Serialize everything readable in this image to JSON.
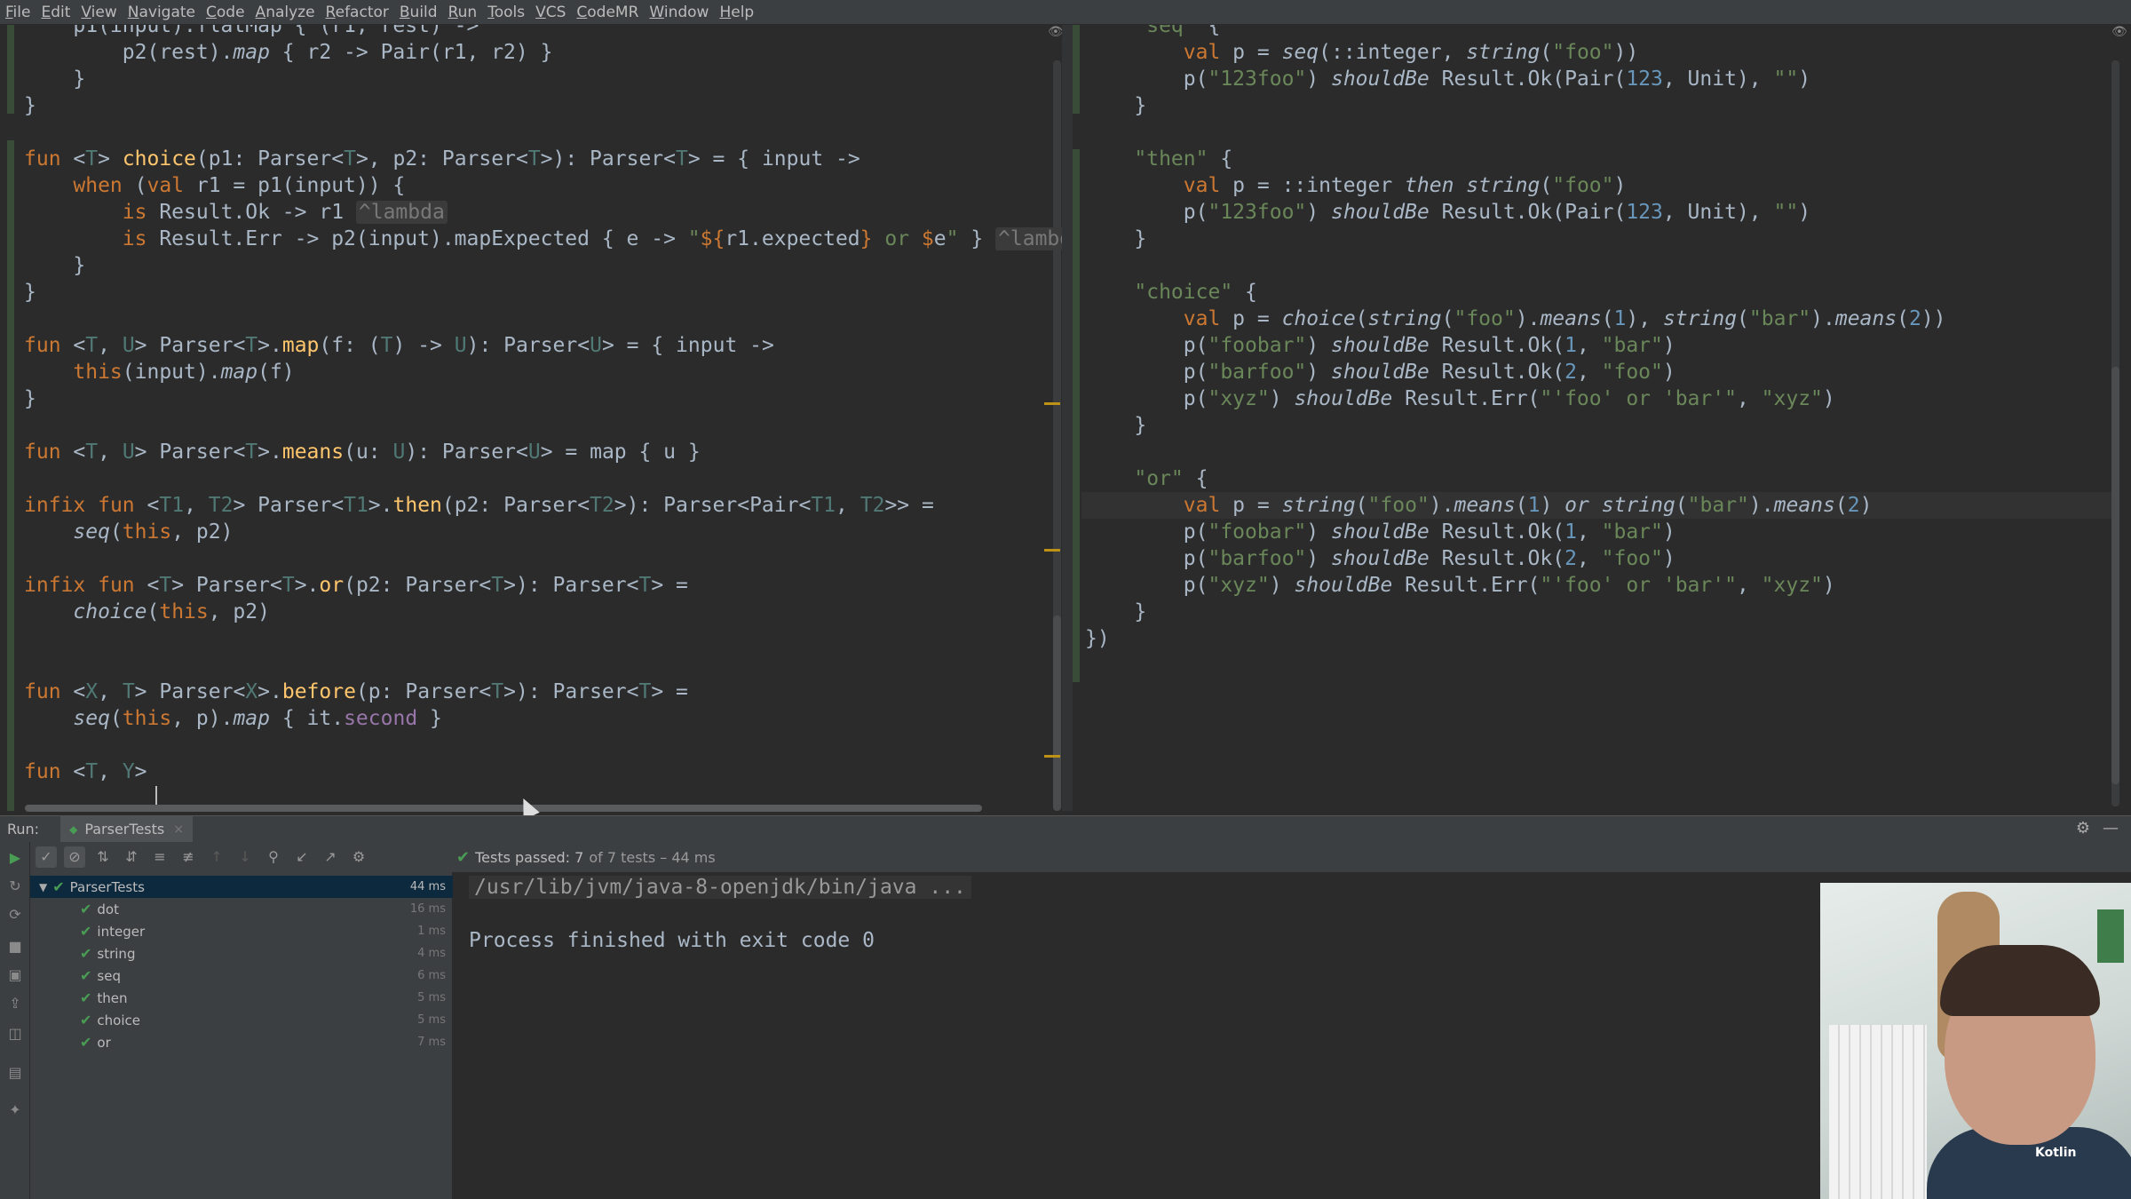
{
  "menubar": {
    "items": [
      "File",
      "Edit",
      "View",
      "Navigate",
      "Code",
      "Analyze",
      "Refactor",
      "Build",
      "Run",
      "Tools",
      "VCS",
      "CodeMR",
      "Window",
      "Help"
    ]
  },
  "editor_left": {
    "lines": [
      "    p1(input).flatMap { (r1, rest) ->",
      "        p2(rest).map { r2 -> Pair(r1, r2) }",
      "    }",
      "}",
      "",
      "fun <T> choice(p1: Parser<T>, p2: Parser<T>): Parser<T> = { input ->",
      "    when (val r1 = p1(input)) {",
      "        is Result.Ok -> r1 ^lambda",
      "        is Result.Err -> p2(input).mapExpected { e -> \"${r1.expected} or $e\" } ^lambd",
      "    }",
      "}",
      "",
      "fun <T, U> Parser<T>.map(f: (T) -> U): Parser<U> = { input ->",
      "    this(input).map(f)",
      "}",
      "",
      "fun <T, U> Parser<T>.means(u: U): Parser<U> = map { u }",
      "",
      "infix fun <T1, T2> Parser<T1>.then(p2: Parser<T2>): Parser<Pair<T1, T2>> =",
      "    seq(this, p2)",
      "",
      "infix fun <T> Parser<T>.or(p2: Parser<T>): Parser<T> =",
      "    choice(this, p2)",
      "",
      "",
      "fun <X, T> Parser<X>.before(p: Parser<T>): Parser<T> =",
      "    seq(this, p).map { it.second }",
      "",
      "fun <T, Y> "
    ]
  },
  "editor_right": {
    "lines": [
      "    \"seq\" {",
      "        val p = seq(::integer, string(\"foo\"))",
      "        p(\"123foo\") shouldBe Result.Ok(Pair(123, Unit), \"\")",
      "    }",
      "",
      "    \"then\" {",
      "        val p = ::integer then string(\"foo\")",
      "        p(\"123foo\") shouldBe Result.Ok(Pair(123, Unit), \"\")",
      "    }",
      "",
      "    \"choice\" {",
      "        val p = choice(string(\"foo\").means(1), string(\"bar\").means(2))",
      "        p(\"foobar\") shouldBe Result.Ok(1, \"bar\")",
      "        p(\"barfoo\") shouldBe Result.Ok(2, \"foo\")",
      "        p(\"xyz\") shouldBe Result.Err(\"'foo' or 'bar'\", \"xyz\")",
      "    }",
      "",
      "    \"or\" {",
      "        val p = string(\"foo\").means(1) or string(\"bar\").means(2)",
      "        p(\"foobar\") shouldBe Result.Ok(1, \"bar\")",
      "        p(\"barfoo\") shouldBe Result.Ok(2, \"foo\")",
      "        p(\"xyz\") shouldBe Result.Err(\"'foo' or 'bar'\", \"xyz\")",
      "    }",
      "})"
    ]
  },
  "run_panel": {
    "run_label": "Run:",
    "tab_label": "ParserTests",
    "status_label": "Tests passed: 7",
    "status_count": "of 7 tests – 44 ms",
    "tree": [
      {
        "name": "ParserTests",
        "time": "44 ms"
      },
      {
        "name": "dot",
        "time": "16 ms"
      },
      {
        "name": "integer",
        "time": "1 ms"
      },
      {
        "name": "string",
        "time": "4 ms"
      },
      {
        "name": "seq",
        "time": "6 ms"
      },
      {
        "name": "then",
        "time": "5 ms"
      },
      {
        "name": "choice",
        "time": "5 ms"
      },
      {
        "name": "or",
        "time": "7 ms"
      }
    ],
    "console": {
      "command": "/usr/lib/jvm/java-8-openjdk/bin/java ...",
      "result": "Process finished with exit code 0"
    }
  },
  "webcam": {
    "shirt_text": "Kotlin"
  }
}
